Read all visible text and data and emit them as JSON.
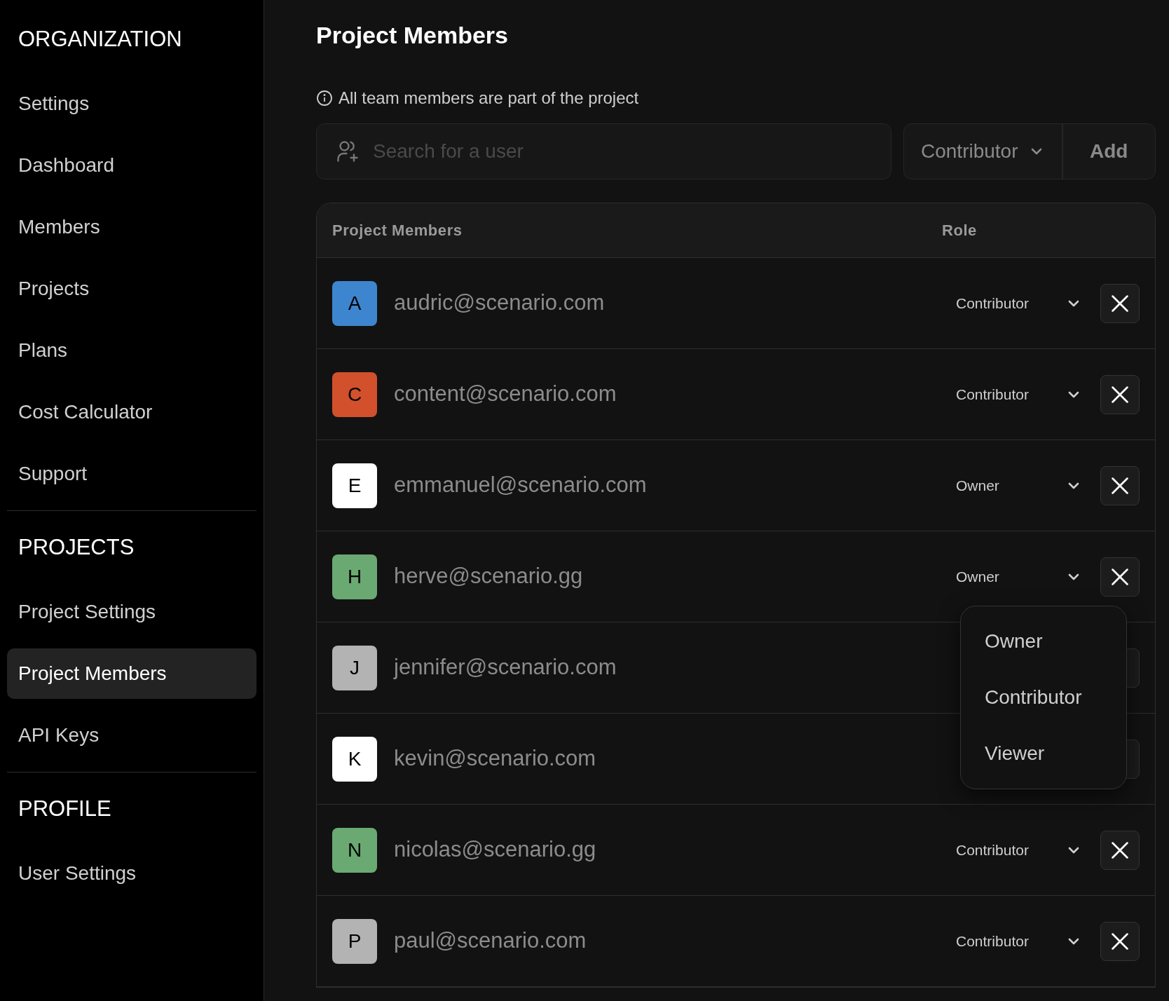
{
  "sidebar": {
    "sections": [
      {
        "heading": "ORGANIZATION",
        "items": [
          {
            "label": "Settings",
            "selected": false
          },
          {
            "label": "Dashboard",
            "selected": false
          },
          {
            "label": "Members",
            "selected": false
          },
          {
            "label": "Projects",
            "selected": false
          },
          {
            "label": "Plans",
            "selected": false
          },
          {
            "label": "Cost Calculator",
            "selected": false
          },
          {
            "label": "Support",
            "selected": false
          }
        ]
      },
      {
        "heading": "PROJECTS",
        "items": [
          {
            "label": "Project Settings",
            "selected": false
          },
          {
            "label": "Project Members",
            "selected": true
          },
          {
            "label": "API Keys",
            "selected": false
          }
        ]
      },
      {
        "heading": "PROFILE",
        "items": [
          {
            "label": "User Settings",
            "selected": false
          }
        ]
      }
    ]
  },
  "page_title": "Project Members",
  "info_note": "All team members are part of the project",
  "search": {
    "placeholder": "Search for a user"
  },
  "role_select": {
    "value": "Contributor"
  },
  "add_button": "Add",
  "table": {
    "columns": [
      "Project Members",
      "Role"
    ],
    "rows": [
      {
        "initial": "A",
        "color": "#3d86cf",
        "email": "audric@scenario.com",
        "role": "Contributor",
        "menu_open": false
      },
      {
        "initial": "C",
        "color": "#d2502c",
        "email": "content@scenario.com",
        "role": "Contributor",
        "menu_open": false
      },
      {
        "initial": "E",
        "color": "#ffffff",
        "email": "emmanuel@scenario.com",
        "role": "Owner",
        "menu_open": false
      },
      {
        "initial": "H",
        "color": "#6aaa72",
        "email": "herve@scenario.gg",
        "role": "Owner",
        "menu_open": true
      },
      {
        "initial": "J",
        "color": "#b3b3b3",
        "email": "jennifer@scenario.com",
        "menu_open": false
      },
      {
        "initial": "K",
        "color": "#ffffff",
        "email": "kevin@scenario.com",
        "menu_open": false
      },
      {
        "initial": "N",
        "color": "#6aaa72",
        "email": "nicolas@scenario.gg",
        "role": "Contributor",
        "menu_open": false
      },
      {
        "initial": "P",
        "color": "#b3b3b3",
        "email": "paul@scenario.com",
        "role": "Contributor",
        "menu_open": false
      }
    ]
  },
  "role_menu": {
    "options": [
      "Owner",
      "Contributor",
      "Viewer"
    ]
  }
}
